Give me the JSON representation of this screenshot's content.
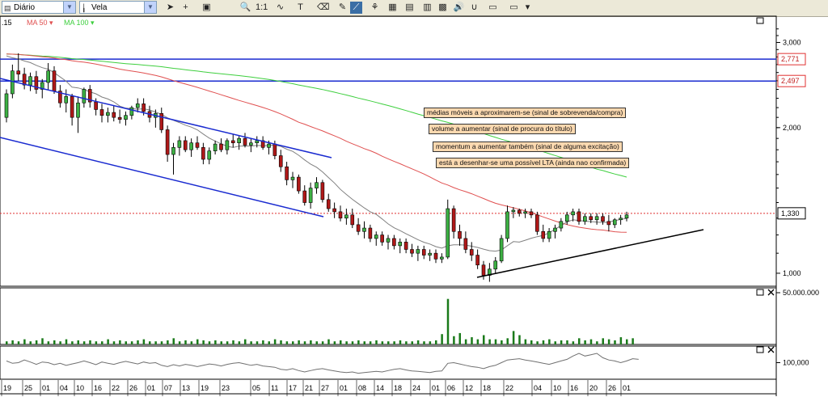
{
  "toolbar": {
    "period_value": "Diário",
    "chart_type_value": "Vela",
    "tools": [
      "cursor-tool",
      "crosshair-tool",
      "data-window-tool",
      "zoom-tool",
      "fit-tool",
      "indicator-tool",
      "text-tool",
      "eraser-tool",
      "draw-tool",
      "trendline-tool",
      "fibonacci-tool",
      "template-tool",
      "compare-tool",
      "layout-tool",
      "chart-tool",
      "sound-tool",
      "magnet-tool",
      "folder-tool",
      "folder-tool-2",
      "more-tool"
    ]
  },
  "legend": {
    "price_prefix": ".15",
    "ma50_label": "MA 50",
    "ma100_label": "MA 100"
  },
  "colors": {
    "ma20": "#808080",
    "ma50": "#e05050",
    "ma100": "#3ecf3e",
    "channel": "#1a2bd0",
    "resistance": "#1a2bd0",
    "support_line": "#e03030",
    "lta": "#000000",
    "label_bg": "#fcd9b0"
  },
  "annotations": [
    "médias móveis a aproximarem-se (sinal de sobrevenda/compra)",
    "volume a aumentar (sinal de procura do título)",
    "momentum a aumentar também (sinal de alguma excitação)",
    "está a desenhar-se uma possível LTA (ainda nao confirmada)"
  ],
  "chart_data": {
    "type": "candlestick",
    "log_scale": true,
    "price_axis": {
      "ticks": [
        3.0,
        2.0,
        1.0
      ],
      "tick_labels": [
        "3,000",
        "2,000",
        "1,000"
      ],
      "range": [
        0.94,
        3.4
      ]
    },
    "levels": [
      {
        "value": 2.771,
        "label": "2,771"
      },
      {
        "value": 2.497,
        "label": "2,497"
      },
      {
        "value": 1.33,
        "label": "1,330"
      }
    ],
    "candles": [
      [
        2.1,
        2.4,
        2.05,
        2.35
      ],
      [
        2.35,
        2.7,
        2.3,
        2.62
      ],
      [
        2.62,
        2.85,
        2.5,
        2.58
      ],
      [
        2.58,
        2.66,
        2.4,
        2.45
      ],
      [
        2.45,
        2.6,
        2.38,
        2.55
      ],
      [
        2.55,
        2.62,
        2.35,
        2.4
      ],
      [
        2.4,
        2.52,
        2.3,
        2.48
      ],
      [
        2.48,
        2.72,
        2.4,
        2.62
      ],
      [
        2.62,
        2.68,
        2.35,
        2.38
      ],
      [
        2.38,
        2.45,
        2.2,
        2.25
      ],
      [
        2.25,
        2.4,
        2.15,
        2.32
      ],
      [
        2.32,
        2.35,
        2.02,
        2.1
      ],
      [
        2.1,
        2.32,
        1.95,
        2.25
      ],
      [
        2.25,
        2.42,
        2.2,
        2.4
      ],
      [
        2.4,
        2.45,
        2.2,
        2.26
      ],
      [
        2.26,
        2.3,
        2.12,
        2.18
      ],
      [
        2.18,
        2.24,
        2.05,
        2.12
      ],
      [
        2.12,
        2.2,
        2.05,
        2.15
      ],
      [
        2.15,
        2.22,
        2.06,
        2.1
      ],
      [
        2.1,
        2.18,
        2.04,
        2.08
      ],
      [
        2.08,
        2.16,
        2.02,
        2.12
      ],
      [
        2.12,
        2.22,
        2.08,
        2.2
      ],
      [
        2.2,
        2.3,
        2.15,
        2.24
      ],
      [
        2.24,
        2.3,
        2.12,
        2.16
      ],
      [
        2.16,
        2.22,
        2.05,
        2.1
      ],
      [
        2.1,
        2.18,
        2.0,
        2.14
      ],
      [
        2.14,
        2.2,
        1.95,
        1.98
      ],
      [
        1.98,
        2.02,
        1.7,
        1.76
      ],
      [
        1.76,
        1.86,
        1.6,
        1.82
      ],
      [
        1.82,
        1.92,
        1.75,
        1.88
      ],
      [
        1.88,
        1.92,
        1.78,
        1.8
      ],
      [
        1.8,
        1.9,
        1.74,
        1.86
      ],
      [
        1.86,
        1.92,
        1.8,
        1.82
      ],
      [
        1.82,
        1.86,
        1.68,
        1.72
      ],
      [
        1.72,
        1.82,
        1.68,
        1.79
      ],
      [
        1.79,
        1.88,
        1.76,
        1.85
      ],
      [
        1.85,
        1.9,
        1.78,
        1.8
      ],
      [
        1.8,
        1.9,
        1.76,
        1.88
      ],
      [
        1.88,
        1.94,
        1.82,
        1.86
      ],
      [
        1.86,
        1.92,
        1.8,
        1.9
      ],
      [
        1.9,
        1.95,
        1.82,
        1.84
      ],
      [
        1.84,
        1.9,
        1.78,
        1.86
      ],
      [
        1.86,
        1.92,
        1.82,
        1.88
      ],
      [
        1.88,
        1.92,
        1.8,
        1.82
      ],
      [
        1.82,
        1.88,
        1.76,
        1.85
      ],
      [
        1.85,
        1.88,
        1.72,
        1.75
      ],
      [
        1.75,
        1.8,
        1.62,
        1.66
      ],
      [
        1.66,
        1.7,
        1.52,
        1.56
      ],
      [
        1.56,
        1.62,
        1.5,
        1.58
      ],
      [
        1.58,
        1.6,
        1.46,
        1.48
      ],
      [
        1.48,
        1.52,
        1.38,
        1.4
      ],
      [
        1.4,
        1.54,
        1.36,
        1.5
      ],
      [
        1.5,
        1.58,
        1.46,
        1.54
      ],
      [
        1.54,
        1.56,
        1.4,
        1.42
      ],
      [
        1.42,
        1.46,
        1.34,
        1.36
      ],
      [
        1.36,
        1.4,
        1.3,
        1.34
      ],
      [
        1.34,
        1.38,
        1.28,
        1.3
      ],
      [
        1.3,
        1.36,
        1.26,
        1.32
      ],
      [
        1.32,
        1.36,
        1.24,
        1.26
      ],
      [
        1.26,
        1.3,
        1.2,
        1.22
      ],
      [
        1.22,
        1.28,
        1.18,
        1.24
      ],
      [
        1.24,
        1.26,
        1.16,
        1.18
      ],
      [
        1.18,
        1.22,
        1.14,
        1.2
      ],
      [
        1.2,
        1.22,
        1.14,
        1.16
      ],
      [
        1.16,
        1.2,
        1.12,
        1.18
      ],
      [
        1.18,
        1.2,
        1.12,
        1.14
      ],
      [
        1.14,
        1.18,
        1.1,
        1.16
      ],
      [
        1.16,
        1.18,
        1.1,
        1.12
      ],
      [
        1.12,
        1.15,
        1.08,
        1.1
      ],
      [
        1.1,
        1.14,
        1.06,
        1.12
      ],
      [
        1.12,
        1.14,
        1.07,
        1.09
      ],
      [
        1.09,
        1.12,
        1.06,
        1.1
      ],
      [
        1.1,
        1.12,
        1.05,
        1.07
      ],
      [
        1.07,
        1.1,
        1.05,
        1.08
      ],
      [
        1.08,
        1.42,
        1.07,
        1.36
      ],
      [
        1.36,
        1.38,
        1.18,
        1.22
      ],
      [
        1.22,
        1.26,
        1.14,
        1.18
      ],
      [
        1.18,
        1.22,
        1.1,
        1.12
      ],
      [
        1.12,
        1.16,
        1.06,
        1.09
      ],
      [
        1.09,
        1.12,
        1.02,
        1.04
      ],
      [
        1.04,
        1.06,
        0.97,
        0.99
      ],
      [
        0.99,
        1.05,
        0.96,
        1.02
      ],
      [
        1.02,
        1.08,
        1.0,
        1.06
      ],
      [
        1.06,
        1.2,
        1.05,
        1.18
      ],
      [
        1.18,
        1.38,
        1.16,
        1.34
      ],
      [
        1.34,
        1.37,
        1.3,
        1.35
      ],
      [
        1.35,
        1.36,
        1.31,
        1.33
      ],
      [
        1.33,
        1.36,
        1.3,
        1.34
      ],
      [
        1.34,
        1.36,
        1.3,
        1.32
      ],
      [
        1.32,
        1.34,
        1.2,
        1.22
      ],
      [
        1.22,
        1.26,
        1.16,
        1.18
      ],
      [
        1.18,
        1.24,
        1.16,
        1.22
      ],
      [
        1.22,
        1.26,
        1.18,
        1.24
      ],
      [
        1.24,
        1.3,
        1.22,
        1.28
      ],
      [
        1.28,
        1.34,
        1.26,
        1.32
      ],
      [
        1.32,
        1.36,
        1.28,
        1.34
      ],
      [
        1.34,
        1.36,
        1.26,
        1.28
      ],
      [
        1.28,
        1.33,
        1.26,
        1.31
      ],
      [
        1.31,
        1.33,
        1.27,
        1.29
      ],
      [
        1.29,
        1.33,
        1.26,
        1.31
      ],
      [
        1.31,
        1.33,
        1.26,
        1.28
      ],
      [
        1.28,
        1.32,
        1.22,
        1.26
      ],
      [
        1.26,
        1.3,
        1.24,
        1.29
      ],
      [
        1.29,
        1.32,
        1.26,
        1.3
      ],
      [
        1.3,
        1.34,
        1.28,
        1.32
      ]
    ],
    "volume": {
      "tick_label": "50.000.000",
      "values": [
        3,
        4,
        3,
        5,
        3,
        4,
        6,
        3,
        4,
        3,
        5,
        3,
        4,
        3,
        4,
        3,
        3,
        5,
        3,
        4,
        3,
        3,
        4,
        5,
        3,
        3,
        3,
        4,
        6,
        3,
        4,
        3,
        5,
        4,
        3,
        4,
        3,
        3,
        4,
        3,
        5,
        3,
        3,
        4,
        3,
        5,
        4,
        3,
        3,
        4,
        3,
        4,
        3,
        3,
        5,
        3,
        4,
        3,
        3,
        4,
        3,
        3,
        4,
        3,
        3,
        3,
        4,
        3,
        3,
        4,
        3,
        3,
        4,
        10,
        44,
        8,
        11,
        5,
        7,
        5,
        9,
        5,
        5,
        4,
        6,
        13,
        9,
        5,
        4,
        3,
        4,
        5,
        3,
        4,
        4,
        3,
        6,
        4,
        5,
        3,
        6,
        5,
        4,
        7,
        5,
        6
      ]
    },
    "momentum": {
      "tick_label": "100,000",
      "values": [
        0.55,
        0.48,
        0.5,
        0.58,
        0.52,
        0.45,
        0.52,
        0.5,
        0.44,
        0.48,
        0.42,
        0.46,
        0.5,
        0.55,
        0.5,
        0.44,
        0.52,
        0.48,
        0.45,
        0.5,
        0.54,
        0.5,
        0.46,
        0.52,
        0.48,
        0.5,
        0.42,
        0.38,
        0.44,
        0.4,
        0.45,
        0.42,
        0.38,
        0.42,
        0.46,
        0.44,
        0.4,
        0.45,
        0.48,
        0.5,
        0.46,
        0.42,
        0.45,
        0.4,
        0.38,
        0.36,
        0.3,
        0.28,
        0.32,
        0.26,
        0.22,
        0.26,
        0.3,
        0.32,
        0.28,
        0.25,
        0.22,
        0.2,
        0.22,
        0.18,
        0.2,
        0.22,
        0.24,
        0.22,
        0.26,
        0.3,
        0.32,
        0.28,
        0.25,
        0.24,
        0.22,
        0.2,
        0.24,
        0.25,
        0.48,
        0.5,
        0.46,
        0.42,
        0.38,
        0.36,
        0.32,
        0.38,
        0.42,
        0.5,
        0.58,
        0.6,
        0.62,
        0.58,
        0.55,
        0.52,
        0.48,
        0.45,
        0.5,
        0.55,
        0.6,
        0.7,
        0.78,
        0.7,
        0.74,
        0.78,
        0.65,
        0.58,
        0.55,
        0.5,
        0.55,
        0.62,
        0.6
      ]
    },
    "x_tick_labels": [
      "19",
      "25",
      "01",
      "04",
      "10",
      "16",
      "22",
      "26",
      "01",
      "07",
      "13",
      "19",
      "23",
      "05",
      "11",
      "17",
      "21",
      "27",
      "01",
      "08",
      "14",
      "18",
      "24",
      "01",
      "06",
      "12",
      "18",
      "22",
      "04",
      "10",
      "16",
      "20",
      "26",
      "01"
    ],
    "x_tick_positions": [
      8,
      34,
      56,
      78,
      98,
      120,
      142,
      164,
      186,
      207,
      229,
      252,
      278,
      316,
      339,
      361,
      381,
      401,
      424,
      447,
      469,
      491,
      514,
      538,
      557,
      579,
      601,
      629,
      664,
      688,
      709,
      733,
      756,
      774
    ]
  }
}
